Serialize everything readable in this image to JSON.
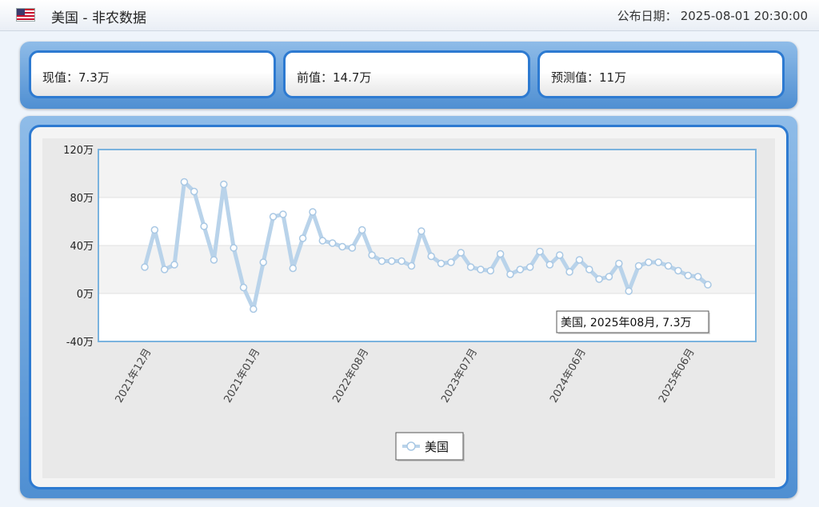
{
  "header": {
    "country": "美国",
    "title": "美国 - 非农数据",
    "publish_label": "公布日期：",
    "publish_value": "2025-08-01 20:30:00"
  },
  "cards": {
    "actual": "现值：7.3万",
    "previous": "前值：14.7万",
    "forecast": "预测值：11万"
  },
  "tooltip": "美国, 2025年08月, 7.3万",
  "chart_data": {
    "type": "line",
    "y_unit": "万",
    "ylim": [
      -40,
      120
    ],
    "y_ticks": [
      -40,
      0,
      40,
      80,
      120
    ],
    "y_tick_labels": [
      "-40万",
      "0万",
      "40万",
      "80万",
      "120万"
    ],
    "x_tick_labels": [
      "2021年12月",
      "2021年01月",
      "2022年08月",
      "2023年07月",
      "2024年06月",
      "2025年06月"
    ],
    "x_tick_index": [
      0,
      11,
      22,
      33,
      44,
      55
    ],
    "grid": true,
    "legend": "bottom-center",
    "series": [
      {
        "name": "美国",
        "color": "#b9d3ea",
        "values": [
          22,
          53,
          20,
          24,
          93,
          85,
          56,
          28,
          91,
          38,
          5,
          -13,
          26,
          64,
          66,
          21,
          46,
          68,
          44,
          42,
          39,
          38,
          53,
          32,
          27,
          27,
          27,
          23,
          52,
          31,
          25,
          26,
          34,
          22,
          20,
          19,
          33,
          16,
          20,
          22,
          35,
          24,
          32,
          18,
          28,
          20,
          12,
          14,
          25,
          2,
          23,
          26,
          26,
          23,
          19,
          15,
          14,
          7.3
        ]
      }
    ]
  }
}
